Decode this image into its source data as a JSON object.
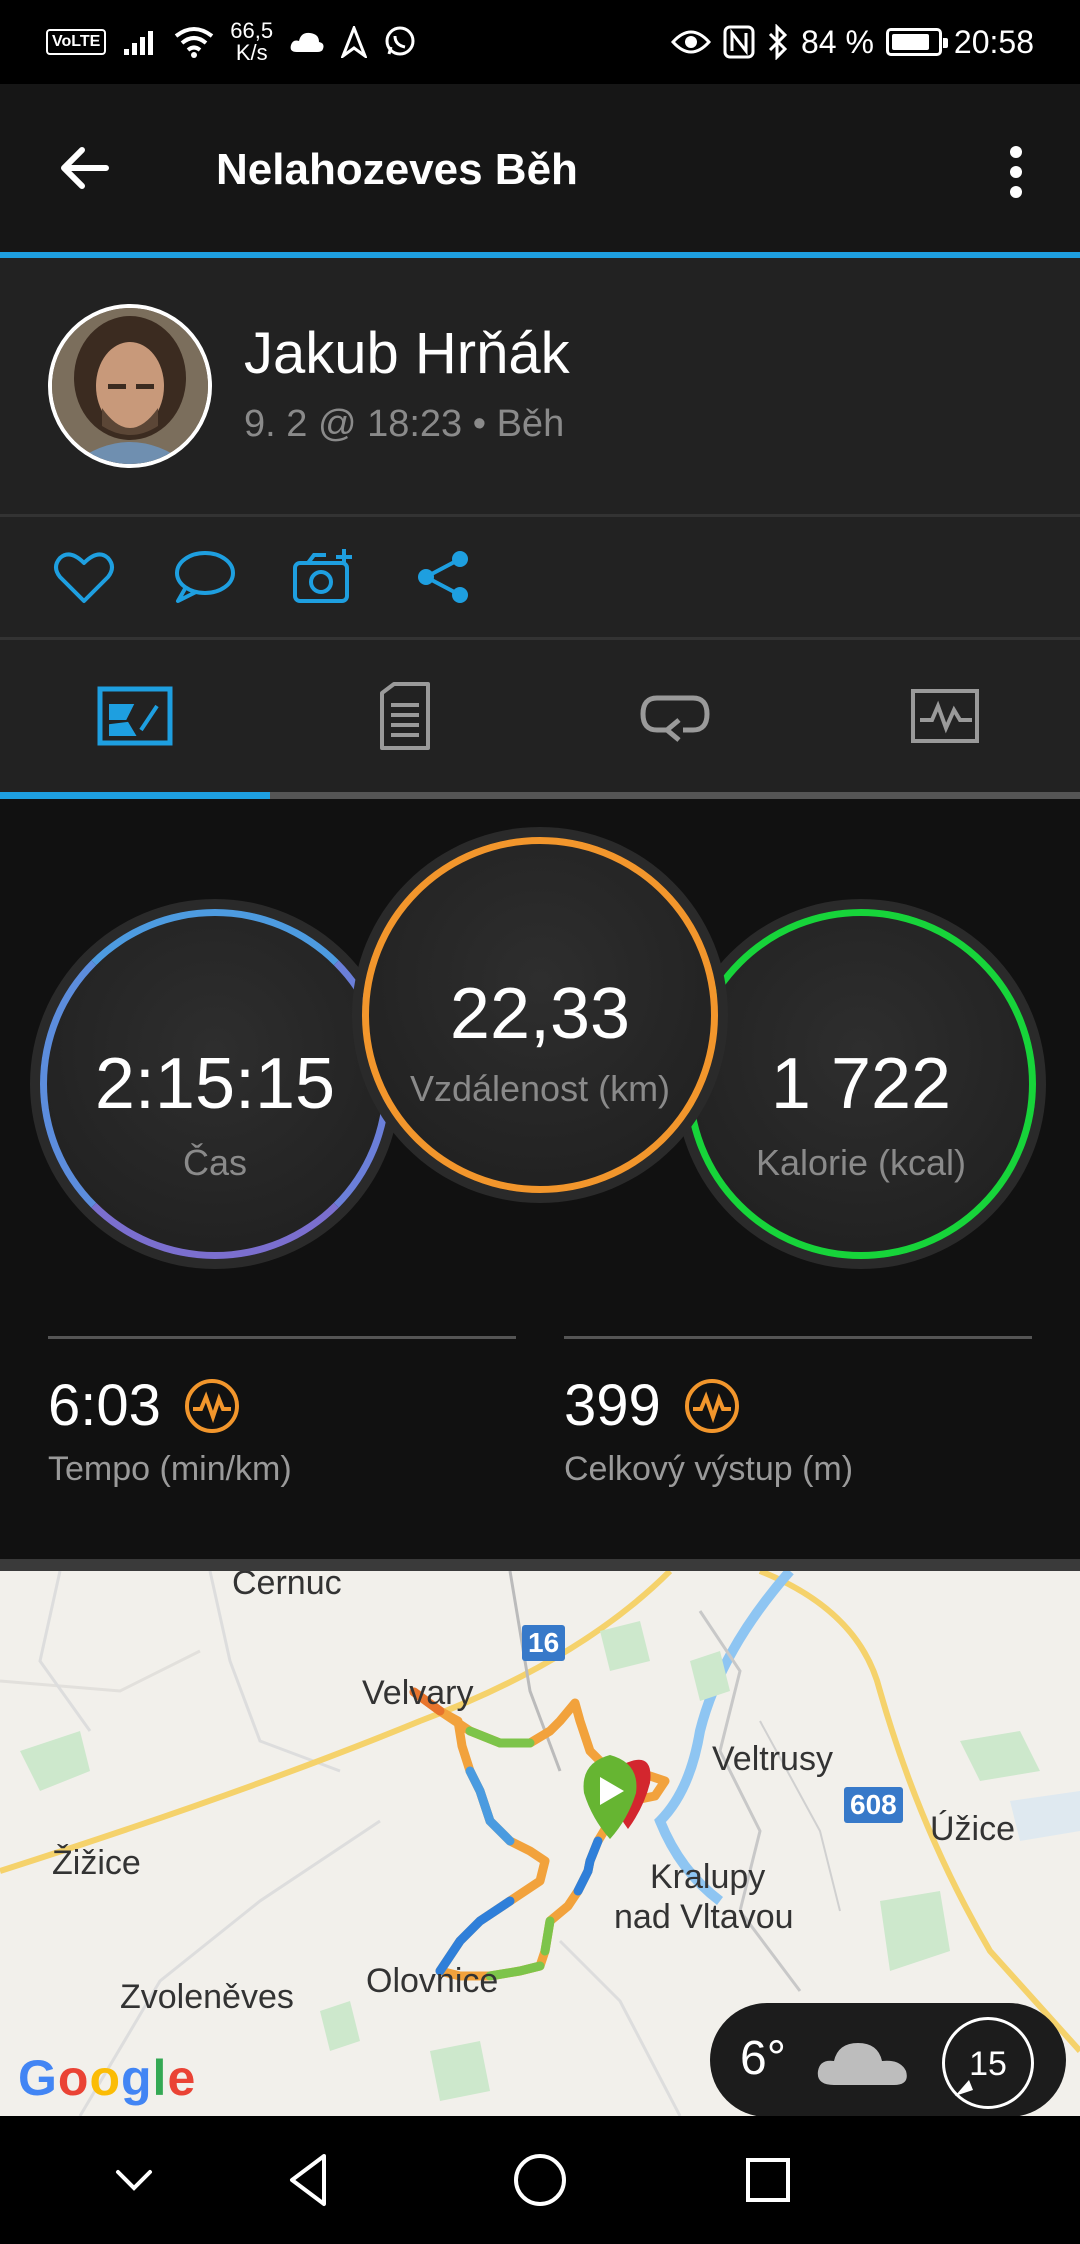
{
  "status_bar": {
    "volte": "VoLTE",
    "net_speed_value": "66,5",
    "net_speed_unit": "K/s",
    "battery_percent": "84 %",
    "battery_level": 0.84,
    "time": "20:58"
  },
  "app_bar": {
    "title": "Nelahozeves Běh",
    "back_icon": "arrow-left-icon",
    "more_icon": "more-vert-icon"
  },
  "profile": {
    "name": "Jakub Hrňák",
    "meta": "9. 2 @ 18:23 • Běh"
  },
  "actions": [
    {
      "name": "like",
      "icon": "heart-icon"
    },
    {
      "name": "comment",
      "icon": "comment-icon"
    },
    {
      "name": "add-photo",
      "icon": "camera-plus-icon"
    },
    {
      "name": "share",
      "icon": "share-icon"
    }
  ],
  "tabs": [
    {
      "name": "overview",
      "icon": "overview-icon",
      "active": true
    },
    {
      "name": "details",
      "icon": "document-icon",
      "active": false
    },
    {
      "name": "laps",
      "icon": "loop-icon",
      "active": false
    },
    {
      "name": "charts",
      "icon": "chart-icon",
      "active": false
    }
  ],
  "stats": {
    "time": {
      "value": "2:15:15",
      "label": "Čas"
    },
    "distance": {
      "value": "22,33",
      "label": "Vzdálenost (km)"
    },
    "calories": {
      "value": "1 722",
      "label": "Kalorie (kcal)"
    },
    "pace": {
      "value": "6:03",
      "label": "Tempo (min/km)"
    },
    "ascent": {
      "value": "399",
      "label": "Celkový výstup (m)"
    }
  },
  "colors": {
    "accent_blue": "#1e9fe0",
    "time_ring": "#4d9be0",
    "distance_ring": "#f2962c",
    "calories_ring": "#17d43a",
    "pulse_orange": "#f2962c"
  },
  "map": {
    "places": [
      "Černuc",
      "Velvary",
      "Veltrusy",
      "Úžice",
      "Žižice",
      "Kralupy",
      "nad Vltavou",
      "Zvoleněves",
      "Olovnice"
    ],
    "road_shields": [
      "16",
      "608"
    ],
    "attribution": "Google",
    "weather": {
      "temp": "6°",
      "icon": "cloud-icon",
      "wind": "15"
    }
  },
  "nav_bar": {
    "icons": [
      "chevron-down-icon",
      "back-triangle-icon",
      "home-circle-icon",
      "recents-square-icon"
    ]
  }
}
